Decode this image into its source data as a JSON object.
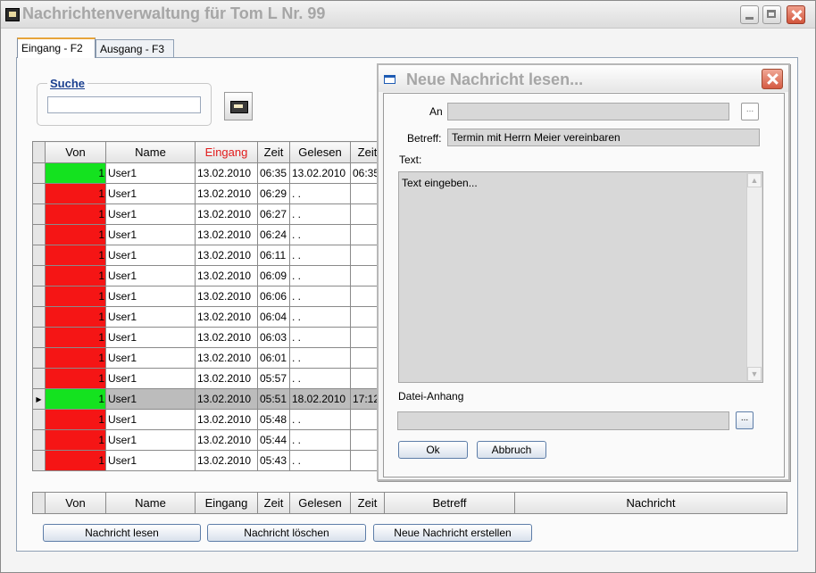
{
  "window": {
    "title": "Nachrichtenverwaltung für Tom L Nr. 99"
  },
  "tabs": [
    {
      "label": "Eingang - F2",
      "active": true
    },
    {
      "label": "Ausgang - F3",
      "active": false
    }
  ],
  "search": {
    "label": "Suche",
    "value": ""
  },
  "grid": {
    "headers": [
      "Von",
      "Name",
      "Eingang",
      "Zeit",
      "Gelesen",
      "Zeit"
    ],
    "sorted_column": "Eingang",
    "rows": [
      {
        "von": "1",
        "status": "green",
        "name": "User1",
        "eingang": "13.02.2010",
        "zeit": "06:35",
        "gelesen": "13.02.2010",
        "zeit2": "06:35"
      },
      {
        "von": "1",
        "status": "red",
        "name": "User1",
        "eingang": "13.02.2010",
        "zeit": "06:29",
        "gelesen": ". .",
        "zeit2": ""
      },
      {
        "von": "1",
        "status": "red",
        "name": "User1",
        "eingang": "13.02.2010",
        "zeit": "06:27",
        "gelesen": ". .",
        "zeit2": ""
      },
      {
        "von": "1",
        "status": "red",
        "name": "User1",
        "eingang": "13.02.2010",
        "zeit": "06:24",
        "gelesen": ". .",
        "zeit2": ""
      },
      {
        "von": "1",
        "status": "red",
        "name": "User1",
        "eingang": "13.02.2010",
        "zeit": "06:11",
        "gelesen": ". .",
        "zeit2": ""
      },
      {
        "von": "1",
        "status": "red",
        "name": "User1",
        "eingang": "13.02.2010",
        "zeit": "06:09",
        "gelesen": ". .",
        "zeit2": ""
      },
      {
        "von": "1",
        "status": "red",
        "name": "User1",
        "eingang": "13.02.2010",
        "zeit": "06:06",
        "gelesen": ". .",
        "zeit2": ""
      },
      {
        "von": "1",
        "status": "red",
        "name": "User1",
        "eingang": "13.02.2010",
        "zeit": "06:04",
        "gelesen": ". .",
        "zeit2": ""
      },
      {
        "von": "1",
        "status": "red",
        "name": "User1",
        "eingang": "13.02.2010",
        "zeit": "06:03",
        "gelesen": ". .",
        "zeit2": ""
      },
      {
        "von": "1",
        "status": "red",
        "name": "User1",
        "eingang": "13.02.2010",
        "zeit": "06:01",
        "gelesen": ". .",
        "zeit2": ""
      },
      {
        "von": "1",
        "status": "red",
        "name": "User1",
        "eingang": "13.02.2010",
        "zeit": "05:57",
        "gelesen": ". .",
        "zeit2": ""
      },
      {
        "von": "1",
        "status": "green",
        "name": "User1",
        "eingang": "13.02.2010",
        "zeit": "05:51",
        "gelesen": "18.02.2010",
        "zeit2": "17:12",
        "selected": true
      },
      {
        "von": "1",
        "status": "red",
        "name": "User1",
        "eingang": "13.02.2010",
        "zeit": "05:48",
        "gelesen": ". .",
        "zeit2": ""
      },
      {
        "von": "1",
        "status": "red",
        "name": "User1",
        "eingang": "13.02.2010",
        "zeit": "05:44",
        "gelesen": ". .",
        "zeit2": ""
      },
      {
        "von": "1",
        "status": "red",
        "name": "User1",
        "eingang": "13.02.2010",
        "zeit": "05:43",
        "gelesen": ". .",
        "zeit2": ""
      }
    ]
  },
  "footer": {
    "cols": [
      "Von",
      "Name",
      "Eingang",
      "Zeit",
      "Gelesen",
      "Zeit",
      "Betreff",
      "Nachricht"
    ]
  },
  "actions": {
    "read": "Nachricht lesen",
    "delete": "Nachricht löschen",
    "create": "Neue Nachricht erstellen"
  },
  "dialog": {
    "title": "Neue Nachricht lesen...",
    "an_label": "An",
    "an_value": "",
    "betreff_label": "Betreff:",
    "betreff_value": "Termin mit Herrn Meier vereinbaren",
    "text_label": "Text:",
    "text_value": "Text eingeben...",
    "attachment_label": "Datei-Anhang",
    "attachment_value": "",
    "ellipsis": "...",
    "ok": "Ok",
    "cancel": "Abbruch"
  },
  "colors": {
    "read": "#14e21f",
    "unread": "#f51515",
    "sort_header": "#e11c1c",
    "selected_row": "#bcbcbc"
  }
}
